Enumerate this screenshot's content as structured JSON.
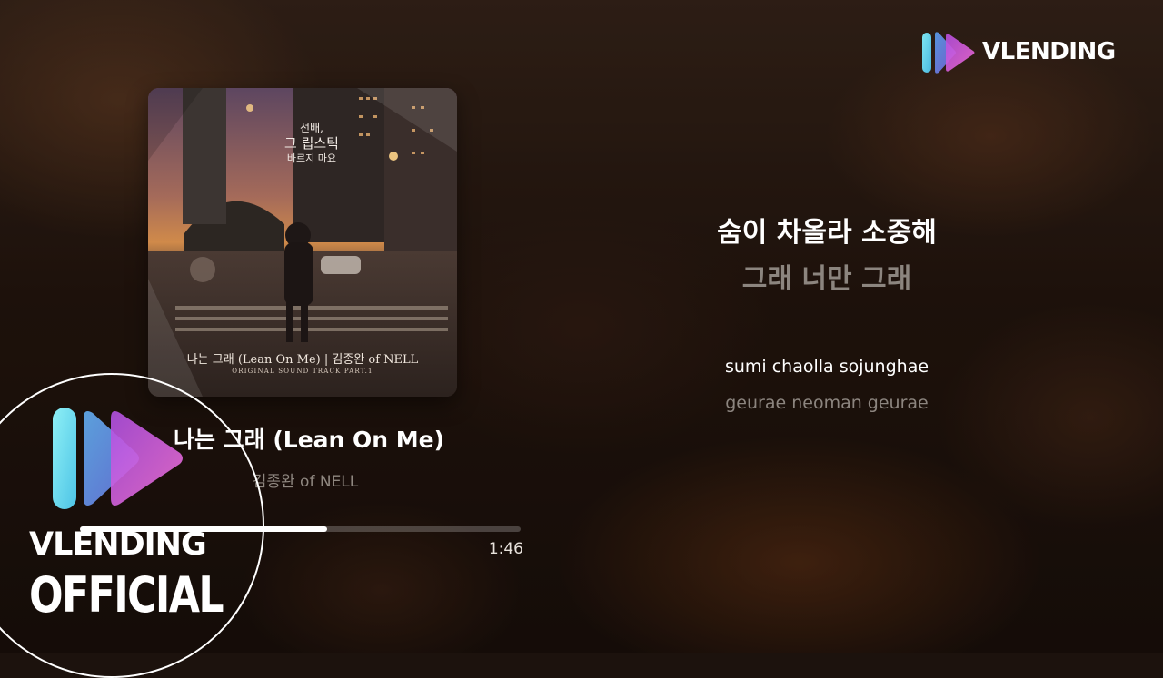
{
  "brand": {
    "logo_text": "VLENDING",
    "logo_icon": "vlending-play-icon",
    "colors": {
      "cyan": "#5fd4e8",
      "blue": "#4a8ee6",
      "magenta": "#c04ad8",
      "pink": "#e86ad8"
    }
  },
  "album": {
    "ost_title_line1": "선배,",
    "ost_title_line2": "그 립스틱",
    "ost_title_line3": "바르지 마요",
    "caption": "나는 그래 (Lean On Me) | 김종완 of NELL",
    "subcaption": "ORIGINAL SOUND TRACK PART.1"
  },
  "track": {
    "title": "나는 그래 (Lean On Me)",
    "artist": "김종완 of NELL",
    "elapsed": "1:46",
    "progress": 0.56
  },
  "lyrics": {
    "current": "숨이 차올라 소중해",
    "next": "그래 너만 그래",
    "romanized_current": "sumi chaolla sojunghae",
    "romanized_next": "geurae neoman geurae"
  },
  "channel_badge": {
    "name": "VLENDING",
    "label": "OFFICIAL"
  }
}
